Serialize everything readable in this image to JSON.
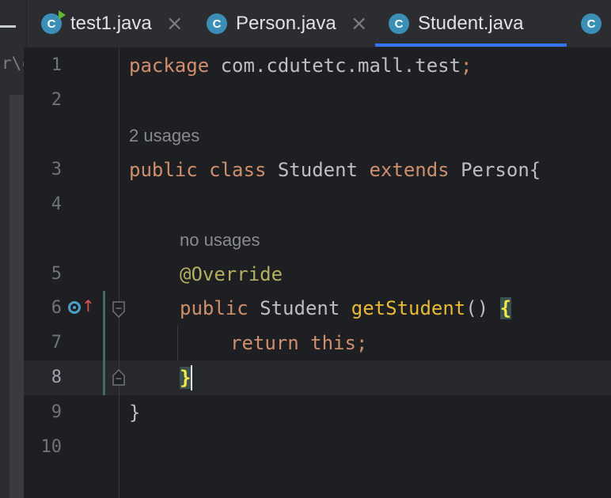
{
  "tabs": [
    {
      "label": "test1.java",
      "icon": "java-class-run-icon",
      "badge": "C",
      "close": "×"
    },
    {
      "label": "Person.java",
      "icon": "java-class-icon",
      "badge": "C",
      "close": "×"
    },
    {
      "label": "Student.java",
      "icon": "java-class-icon",
      "badge": "C",
      "active": true
    },
    {
      "label": "",
      "icon": "java-class-icon",
      "badge": "C"
    }
  ],
  "left_fragment": "r\\cd",
  "line_numbers": [
    "1",
    "2",
    "3",
    "4",
    "5",
    "6",
    "7",
    "8",
    "9",
    "10"
  ],
  "current_line": "8",
  "hints": {
    "class_usages": "2 usages",
    "method_usages": "no usages"
  },
  "code": {
    "l1_kw": "package",
    "l1_rest": " com.cdutetc.mall.test",
    "l1_semi": ";",
    "l3_kw1": "public",
    "l3_kw2": "class",
    "l3_name": "Student",
    "l3_kw3": "extends",
    "l3_parent": "Person{",
    "l5_anno": "@Override",
    "l6_kw": "public",
    "l6_type": "Student",
    "l6_method": "getStudent",
    "l6_parens": "()",
    "l6_brace": "{",
    "l7_kw1": "return",
    "l7_kw2": "this",
    "l7_semi": ";",
    "l8_brace": "}",
    "l9_brace": "}"
  },
  "colors": {
    "keyword": "#cf8e6d",
    "annotation": "#b3ae60",
    "method": "#e8ba36",
    "text": "#bcbec4",
    "tab_accent": "#3574f0"
  }
}
